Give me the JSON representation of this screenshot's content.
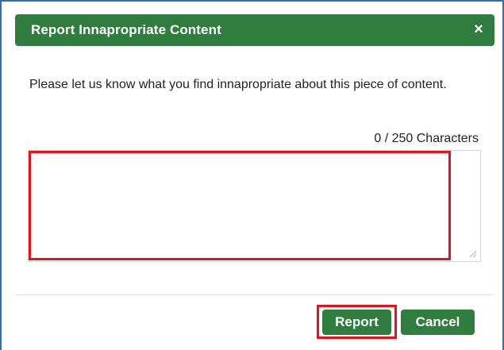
{
  "dialog": {
    "title": "Report Innapropriate Content",
    "close_label": "×",
    "message": "Please let us know what you find innapropriate about this piece of content.",
    "counter": "0 / 250 Characters",
    "textarea_value": "",
    "buttons": {
      "report": "Report",
      "cancel": "Cancel"
    }
  },
  "colors": {
    "header_green": "#2f7d3f",
    "button_green": "#2f7d3f",
    "highlight_red": "#e8101a",
    "frame_blue": "#2e6fb7"
  },
  "icons": {
    "close": "close-icon",
    "resize": "resize-grip-icon"
  }
}
